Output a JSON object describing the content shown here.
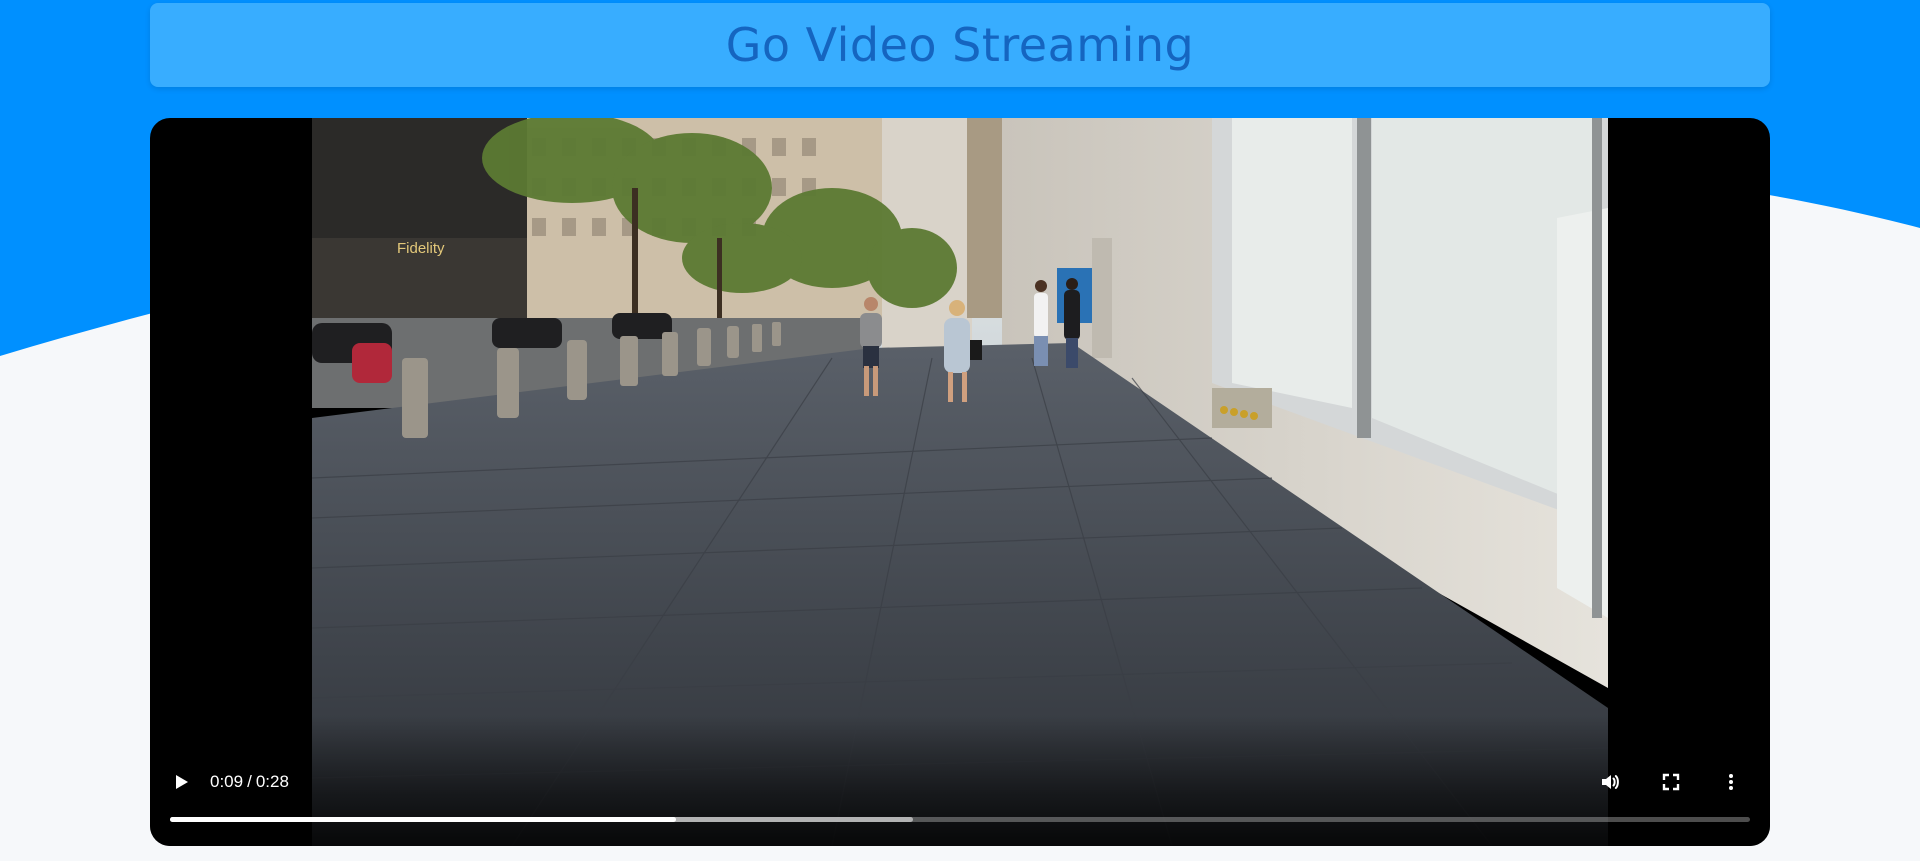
{
  "header": {
    "title": "Go Video Streaming"
  },
  "colors": {
    "page_background": "#f6f8fa",
    "wave": "#0090ff",
    "header_background": "#38adff",
    "title_text": "#1565c0"
  },
  "player": {
    "current_time": "0:09",
    "duration": "0:28",
    "separator": "/",
    "played_fraction": 0.32,
    "buffered_fraction": 0.47,
    "icons": {
      "play": "play-icon",
      "volume": "volume-icon",
      "fullscreen": "fullscreen-icon",
      "more": "more-options-icon"
    }
  },
  "video_scene": {
    "storefront_sign": "Fidelity"
  }
}
